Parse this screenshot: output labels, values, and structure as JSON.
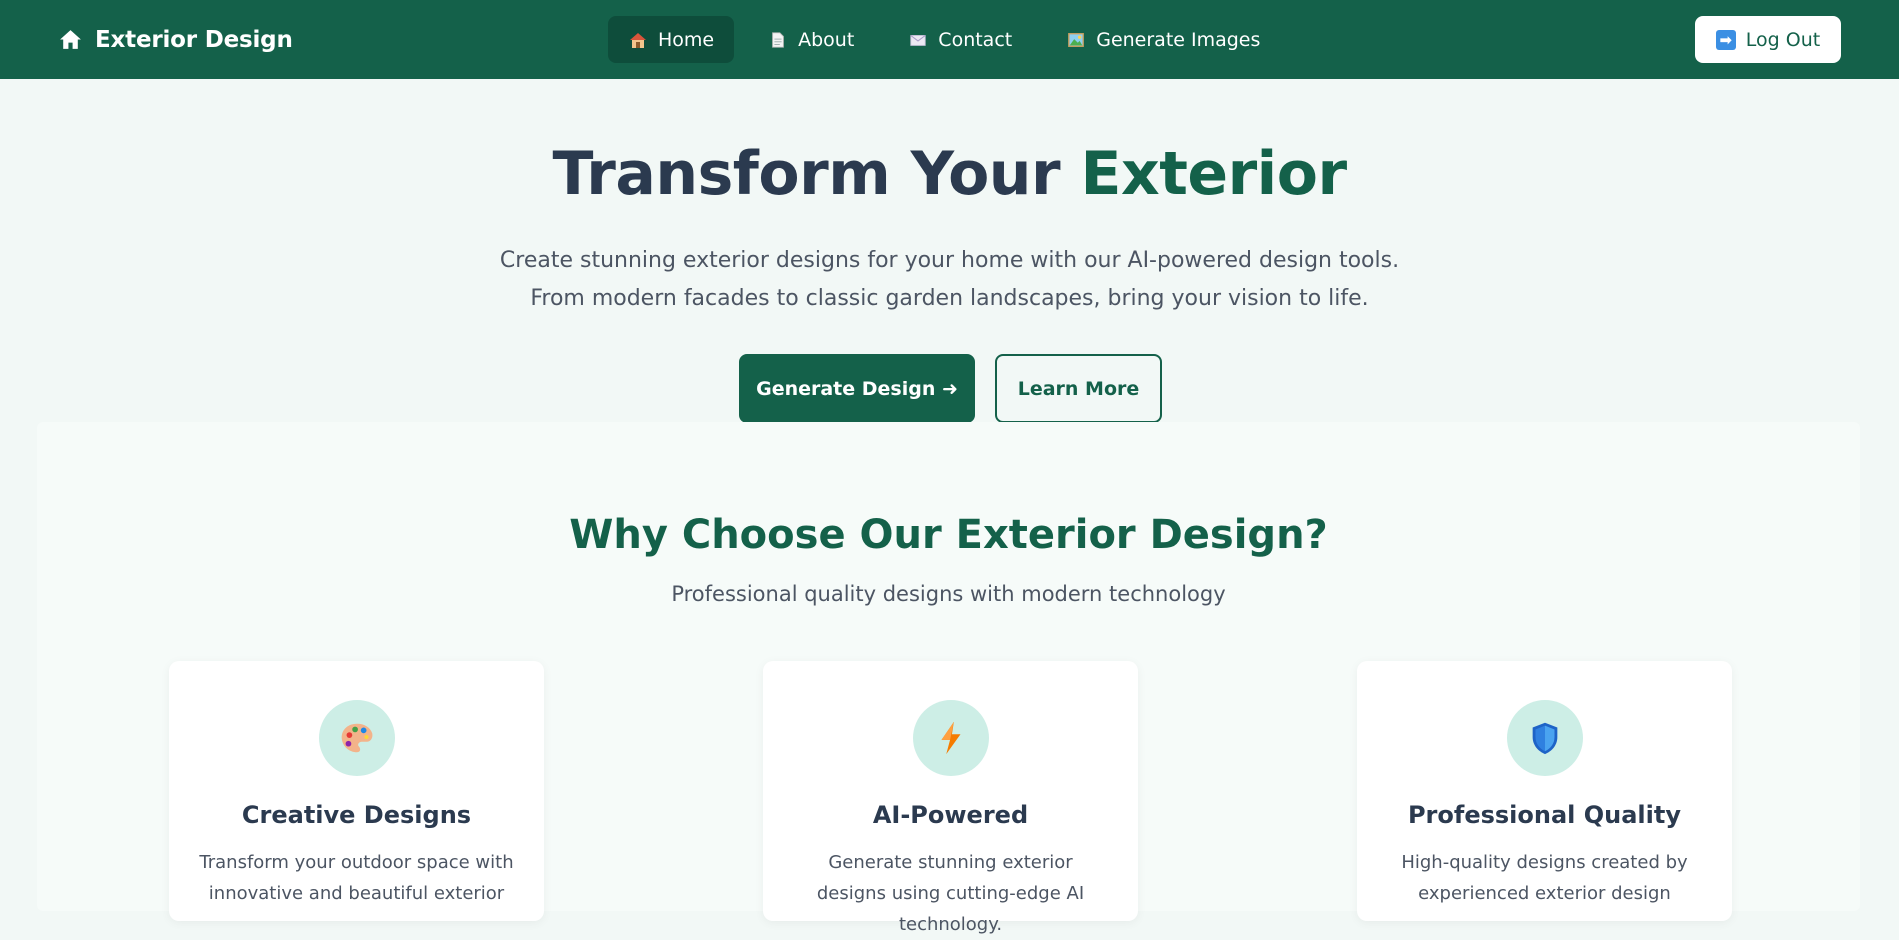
{
  "nav": {
    "brand": "Exterior Design",
    "links": [
      {
        "label": "Home",
        "icon": "house-icon"
      },
      {
        "label": "About",
        "icon": "document-icon"
      },
      {
        "label": "Contact",
        "icon": "envelope-icon"
      },
      {
        "label": "Generate Images",
        "icon": "picture-icon"
      }
    ],
    "logout": "Log Out"
  },
  "hero": {
    "title_part1": "Transform Your ",
    "title_part2": "Exterior",
    "subtitle_line1": "Create stunning exterior designs for your home with our AI-powered design tools.",
    "subtitle_line2": "From modern facades to classic garden landscapes, bring your vision to life.",
    "primary_button": "Generate Design ➜",
    "secondary_button": "Learn More"
  },
  "features": {
    "title": "Why Choose Our Exterior Design?",
    "subtitle": "Professional quality designs with modern technology",
    "cards": [
      {
        "title": "Creative Designs",
        "text": "Transform your outdoor space with innovative and beautiful exterior",
        "icon": "palette-icon"
      },
      {
        "title": "AI-Powered",
        "text": "Generate stunning exterior designs using cutting-edge AI technology.",
        "icon": "lightning-icon"
      },
      {
        "title": "Professional Quality",
        "text": "High-quality designs created by experienced exterior design",
        "icon": "shield-icon"
      }
    ]
  },
  "colors": {
    "brand_green": "#14614a",
    "active_nav": "#0e4d3b",
    "heading_dark": "#2b3a4f",
    "icon_circle": "#cdeee6"
  }
}
